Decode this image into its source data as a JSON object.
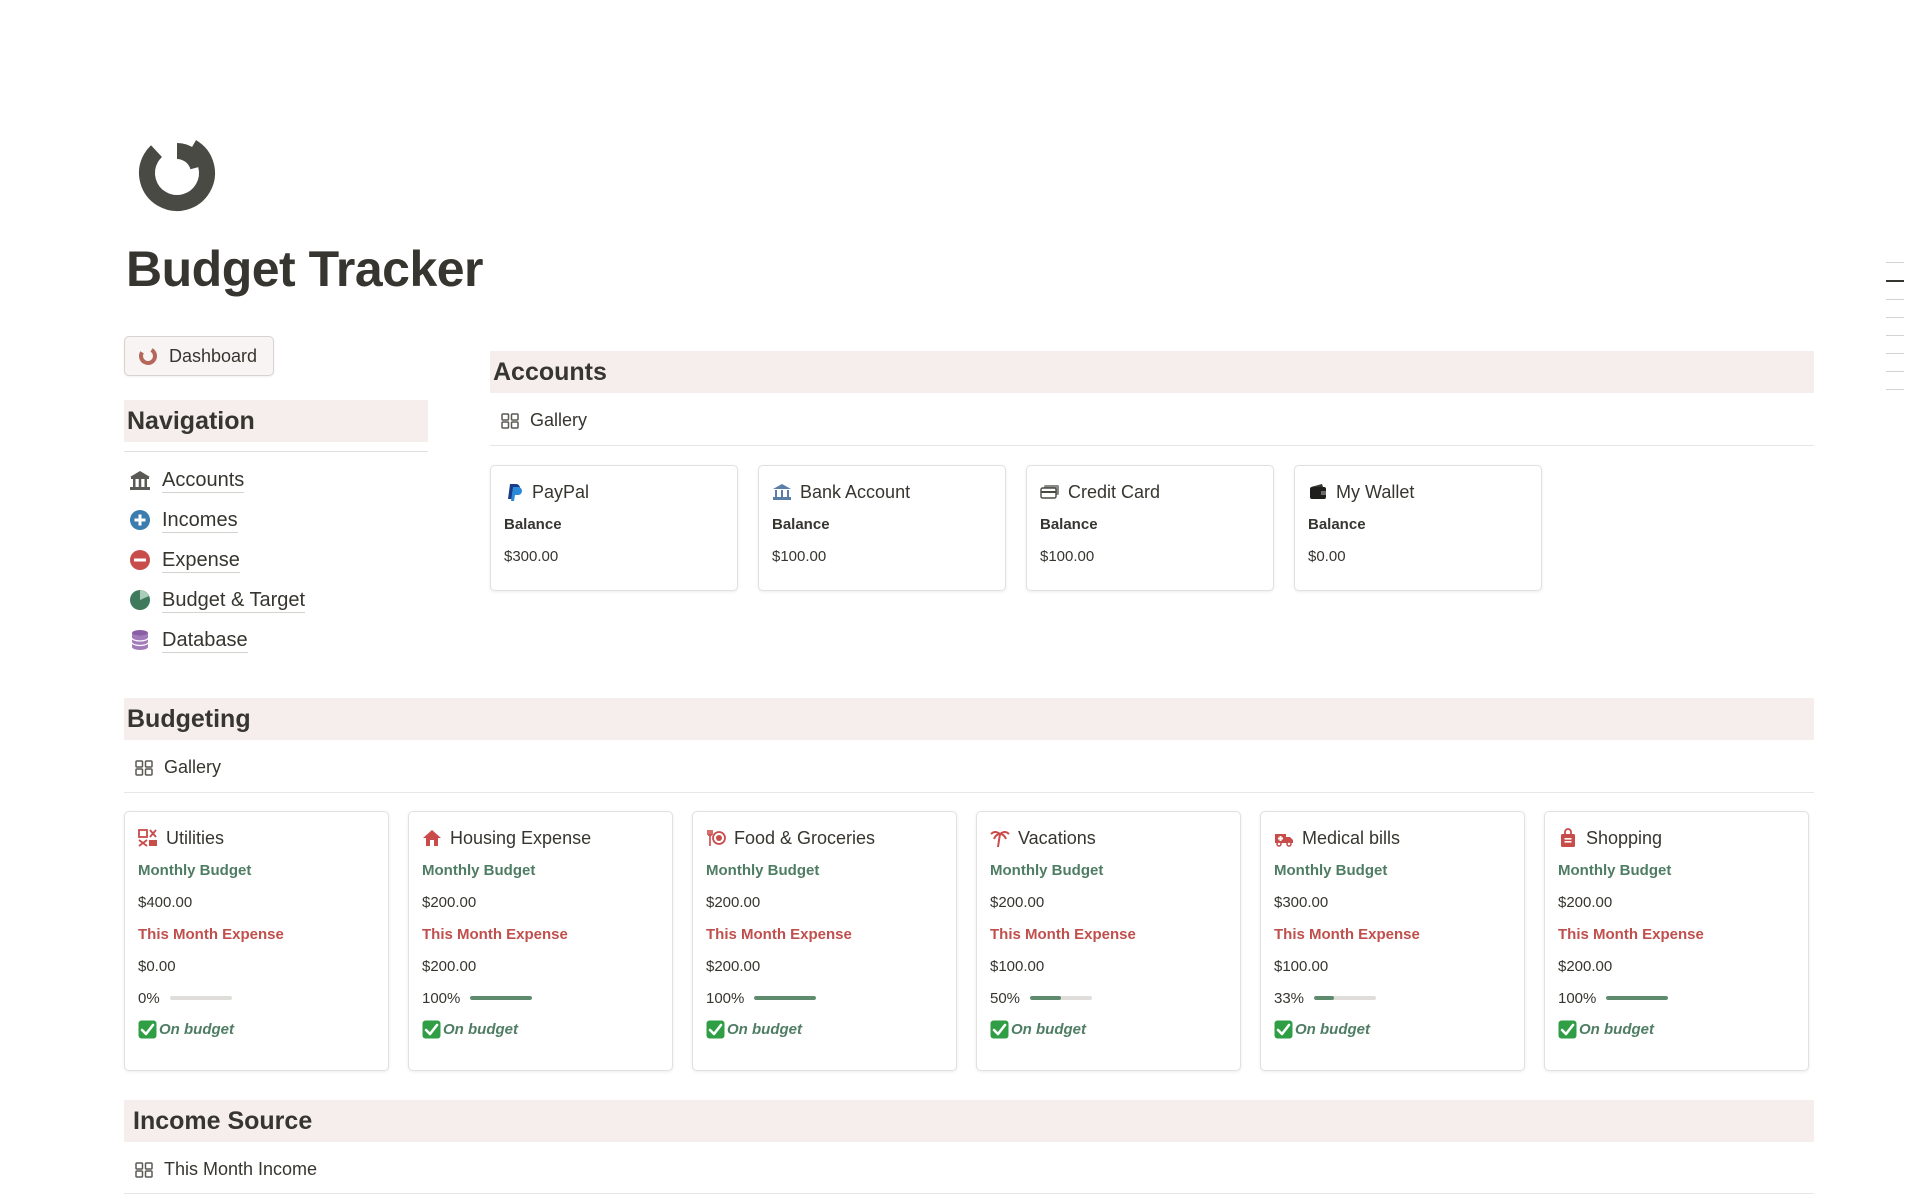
{
  "page": {
    "title": "Budget Tracker",
    "icon": "pie-chart-icon"
  },
  "dashboard_button": {
    "label": "Dashboard",
    "icon": "pie-chart-icon"
  },
  "navigation": {
    "title": "Navigation",
    "items": [
      {
        "label": "Accounts",
        "icon": "bank-icon"
      },
      {
        "label": "Incomes",
        "icon": "plus-circle-icon"
      },
      {
        "label": "Expense",
        "icon": "minus-circle-icon"
      },
      {
        "label": "Budget & Target",
        "icon": "pie-chart-icon"
      },
      {
        "label": "Database",
        "icon": "database-icon"
      }
    ]
  },
  "accounts": {
    "title": "Accounts",
    "view": "Gallery",
    "cards": [
      {
        "name": "PayPal",
        "icon": "paypal-icon",
        "label": "Balance",
        "value": "$300.00"
      },
      {
        "name": "Bank Account",
        "icon": "bank-icon",
        "label": "Balance",
        "value": "$100.00"
      },
      {
        "name": "Credit Card",
        "icon": "credit-card-icon",
        "label": "Balance",
        "value": "$100.00"
      },
      {
        "name": "My Wallet",
        "icon": "wallet-icon",
        "label": "Balance",
        "value": "$0.00"
      }
    ]
  },
  "budgeting": {
    "title": "Budgeting",
    "view": "Gallery",
    "budget_label": "Monthly Budget",
    "expense_label": "This Month Expense",
    "cards": [
      {
        "name": "Utilities",
        "icon": "utilities-icon",
        "budget": "$400.00",
        "expense": "$0.00",
        "percent_label": "0%",
        "percent": 0,
        "status": "On budget"
      },
      {
        "name": "Housing Expense",
        "icon": "house-icon",
        "budget": "$200.00",
        "expense": "$200.00",
        "percent_label": "100%",
        "percent": 100,
        "status": "On budget"
      },
      {
        "name": "Food & Groceries",
        "icon": "fork-plate-icon",
        "budget": "$200.00",
        "expense": "$200.00",
        "percent_label": "100%",
        "percent": 100,
        "status": "On budget"
      },
      {
        "name": "Vacations",
        "icon": "palm-tree-icon",
        "budget": "$200.00",
        "expense": "$100.00",
        "percent_label": "50%",
        "percent": 50,
        "status": "On budget"
      },
      {
        "name": "Medical bills",
        "icon": "ambulance-icon",
        "budget": "$300.00",
        "expense": "$100.00",
        "percent_label": "33%",
        "percent": 33,
        "status": "On budget"
      },
      {
        "name": "Shopping",
        "icon": "shopping-bag-icon",
        "budget": "$200.00",
        "expense": "$200.00",
        "percent_label": "100%",
        "percent": 100,
        "status": "On budget"
      }
    ]
  },
  "income_source": {
    "title": "Income Source",
    "view": "This Month Income"
  },
  "colors": {
    "header_bg": "#f5eeed",
    "budget_green": "#4f7d63",
    "expense_red": "#c0504d",
    "bar_fill": "#5e8a6e"
  }
}
